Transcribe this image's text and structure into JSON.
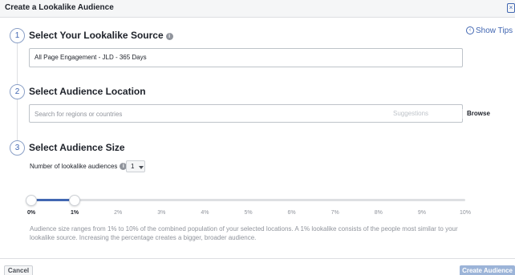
{
  "dialog": {
    "title": "Create a Lookalike Audience",
    "show_tips": "Show Tips"
  },
  "steps": [
    {
      "number": "1",
      "title": "Select Your Lookalike Source"
    },
    {
      "number": "2",
      "title": "Select Audience Location"
    },
    {
      "number": "3",
      "title": "Select Audience Size"
    }
  ],
  "source": {
    "value": "All Page Engagement - JLD - 365 Days"
  },
  "location": {
    "placeholder": "Search for regions or countries",
    "suggestions_label": "Suggestions",
    "browse_label": "Browse"
  },
  "size": {
    "num_label": "Number of lookalike audiences",
    "num_value": "1",
    "slider_ticks": [
      "0%",
      "1%",
      "2%",
      "3%",
      "4%",
      "5%",
      "6%",
      "7%",
      "8%",
      "9%",
      "10%"
    ],
    "range_start_percent": 0,
    "range_end_percent": 1,
    "description": "Audience size ranges from 1% to 10% of the combined population of your selected locations. A 1% lookalike consists of the people most similar to your lookalike source. Increasing the percentage creates a bigger, broader audience."
  },
  "footer": {
    "cancel_label": "Cancel",
    "create_label": "Create Audience"
  },
  "colors": {
    "accent": "#4267b2",
    "disabled_button": "#9cb4d8"
  }
}
